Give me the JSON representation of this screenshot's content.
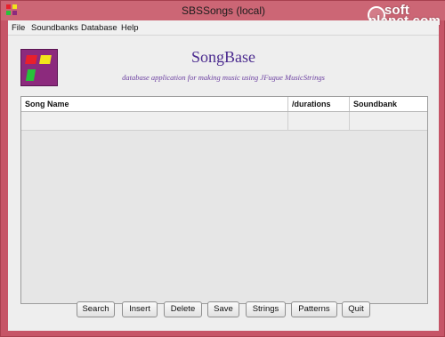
{
  "window": {
    "title": "SBSSongs (local)",
    "watermark": "soft planet.com"
  },
  "menu": [
    "File",
    "Soundbanks",
    "Database",
    "Help"
  ],
  "header": {
    "title": "SongBase",
    "subtitle": "database application for making music using JFugue MusicStrings"
  },
  "table": {
    "columns": [
      "Song Name",
      "/durations",
      "Soundbank"
    ],
    "rows": [
      [
        "",
        "",
        ""
      ]
    ]
  },
  "buttons": [
    "Search",
    "Insert",
    "Delete",
    "Save",
    "Strings",
    "Patterns",
    "Quit"
  ],
  "colors": {
    "window_frame": "#c65567",
    "logo_background": "#8c2a7d",
    "title_color": "#4b2b8f",
    "logo_red": "#e8202b",
    "logo_yellow": "#f2e51b",
    "logo_green": "#27c23a"
  }
}
